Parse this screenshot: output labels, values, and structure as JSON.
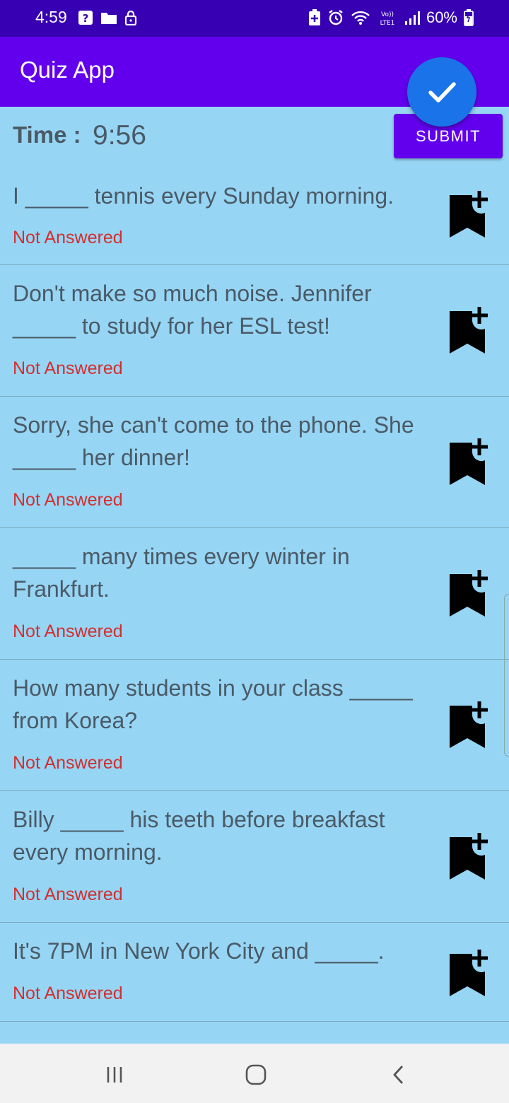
{
  "status_bar": {
    "time": "4:59",
    "battery": "60%",
    "icons_left": [
      "notification-icon",
      "folder-icon",
      "lock-icon"
    ],
    "icons_right": [
      "battery-saver-icon",
      "alarm-icon",
      "wifi-icon",
      "volte-icon",
      "signal-icon",
      "battery-icon"
    ]
  },
  "app_bar": {
    "title": "Quiz App"
  },
  "fab": {
    "icon": "check-icon",
    "color": "#1a73e8"
  },
  "submit": {
    "label": "SUBMIT"
  },
  "timer": {
    "label": "Time :",
    "value": "9:56"
  },
  "questions": [
    {
      "text": "I _____ tennis every Sunday morning.",
      "status": "Not Answered"
    },
    {
      "text": "Don't make so much noise. Jennifer _____ to study for her ESL test!",
      "status": "Not Answered"
    },
    {
      "text": "Sorry, she can't come to the phone. She _____ her dinner!",
      "status": "Not Answered"
    },
    {
      "text": "_____ many times every winter in Frankfurt.",
      "status": "Not Answered"
    },
    {
      "text": "How many students in your class _____ from Korea?",
      "status": "Not Answered"
    },
    {
      "text": "Billy _____ his teeth before breakfast every morning.",
      "status": "Not Answered"
    },
    {
      "text": "It's 7PM in New York City and _____.",
      "status": "Not Answered"
    }
  ],
  "colors": {
    "primary": "#6200ee",
    "primary_dark": "#3700b3",
    "background": "#97d5f4",
    "status_red": "#d32f2f"
  }
}
